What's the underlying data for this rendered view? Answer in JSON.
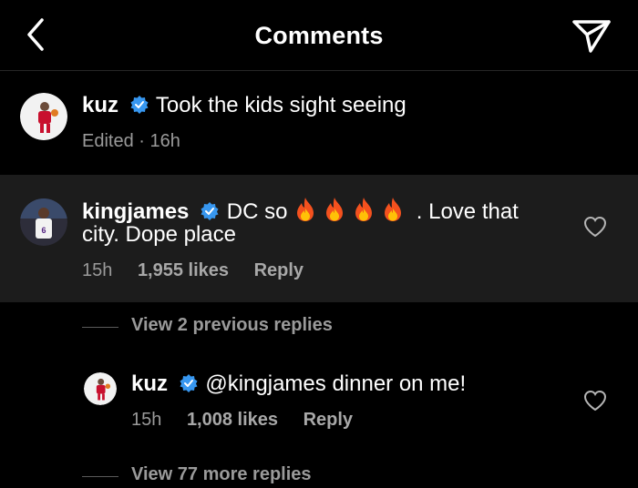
{
  "header": {
    "title": "Comments",
    "back_icon": "chevron-left-icon",
    "send_icon": "paper-plane-icon"
  },
  "caption": {
    "username": "kuz",
    "text": "Took the kids sight seeing",
    "meta": "Edited · 16h"
  },
  "comments": [
    {
      "username": "kingjames",
      "text_before": "DC so ",
      "emoji": "fire",
      "emoji_count": 4,
      "text_after": ". Love that",
      "text_line2": "city. Dope place",
      "time": "15h",
      "likes": "1,955 likes",
      "reply": "Reply"
    }
  ],
  "view_previous_replies": "View 2 previous replies",
  "replies": [
    {
      "username": "kuz",
      "text": "@kingjames dinner on me!",
      "time": "15h",
      "likes": "1,008 likes",
      "reply": "Reply"
    }
  ],
  "view_more_replies": "View 77 more replies",
  "colors": {
    "background": "#000000",
    "highlight": "#1c1c1c",
    "verified": "#3797f0",
    "secondary_text": "#9a9a9a"
  }
}
